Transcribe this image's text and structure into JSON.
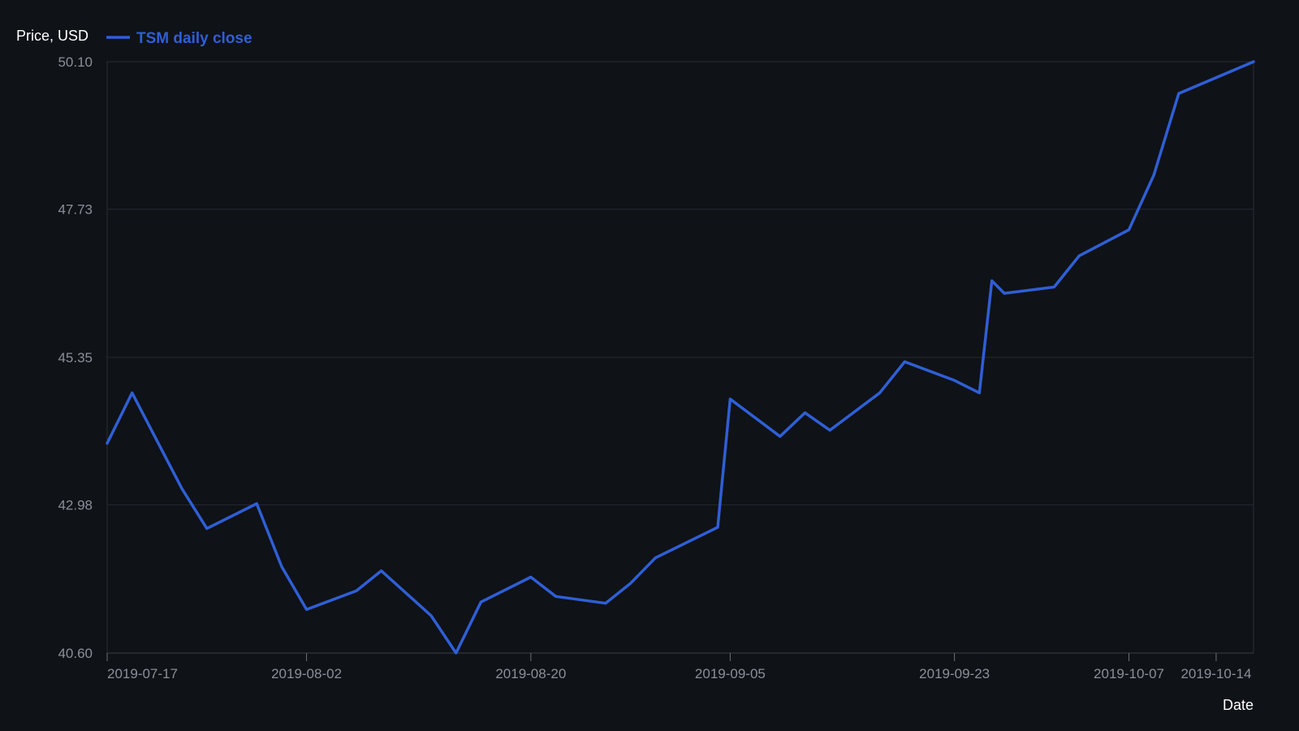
{
  "chart_data": {
    "type": "line",
    "title": "",
    "xlabel": "Date",
    "ylabel": "Price, USD",
    "x_axis_type": "date",
    "xlim": [
      "2019-07-17",
      "2019-10-17"
    ],
    "ylim": [
      40.6,
      50.1
    ],
    "y_ticks": [
      "40.60",
      "42.98",
      "45.35",
      "47.73",
      "50.10"
    ],
    "x_ticks": [
      "2019-07-17",
      "2019-08-02",
      "2019-08-20",
      "2019-09-05",
      "2019-09-23",
      "2019-10-07",
      "2019-10-14"
    ],
    "grid": true,
    "legend_position": "top-left",
    "series": [
      {
        "name": "TSM daily close",
        "color": "#2f5fd6",
        "points": [
          {
            "x": "2019-07-17",
            "y": 43.97
          },
          {
            "x": "2019-07-19",
            "y": 44.78
          },
          {
            "x": "2019-07-23",
            "y": 43.24
          },
          {
            "x": "2019-07-25",
            "y": 42.6
          },
          {
            "x": "2019-07-29",
            "y": 43.0
          },
          {
            "x": "2019-07-31",
            "y": 41.99
          },
          {
            "x": "2019-08-02",
            "y": 41.3
          },
          {
            "x": "2019-08-06",
            "y": 41.6
          },
          {
            "x": "2019-08-08",
            "y": 41.92
          },
          {
            "x": "2019-08-12",
            "y": 41.2
          },
          {
            "x": "2019-08-14",
            "y": 40.6
          },
          {
            "x": "2019-08-16",
            "y": 41.42
          },
          {
            "x": "2019-08-20",
            "y": 41.82
          },
          {
            "x": "2019-08-22",
            "y": 41.51
          },
          {
            "x": "2019-08-26",
            "y": 41.4
          },
          {
            "x": "2019-08-28",
            "y": 41.72
          },
          {
            "x": "2019-08-30",
            "y": 42.13
          },
          {
            "x": "2019-09-04",
            "y": 42.62
          },
          {
            "x": "2019-09-05",
            "y": 44.68
          },
          {
            "x": "2019-09-09",
            "y": 44.08
          },
          {
            "x": "2019-09-11",
            "y": 44.46
          },
          {
            "x": "2019-09-13",
            "y": 44.18
          },
          {
            "x": "2019-09-17",
            "y": 44.78
          },
          {
            "x": "2019-09-19",
            "y": 45.28
          },
          {
            "x": "2019-09-23",
            "y": 44.98
          },
          {
            "x": "2019-09-25",
            "y": 44.78
          },
          {
            "x": "2019-09-26",
            "y": 46.58
          },
          {
            "x": "2019-09-27",
            "y": 46.38
          },
          {
            "x": "2019-10-01",
            "y": 46.48
          },
          {
            "x": "2019-10-03",
            "y": 46.98
          },
          {
            "x": "2019-10-07",
            "y": 47.4
          },
          {
            "x": "2019-10-09",
            "y": 48.28
          },
          {
            "x": "2019-10-11",
            "y": 49.59
          },
          {
            "x": "2019-10-17",
            "y": 50.1
          }
        ]
      }
    ]
  }
}
